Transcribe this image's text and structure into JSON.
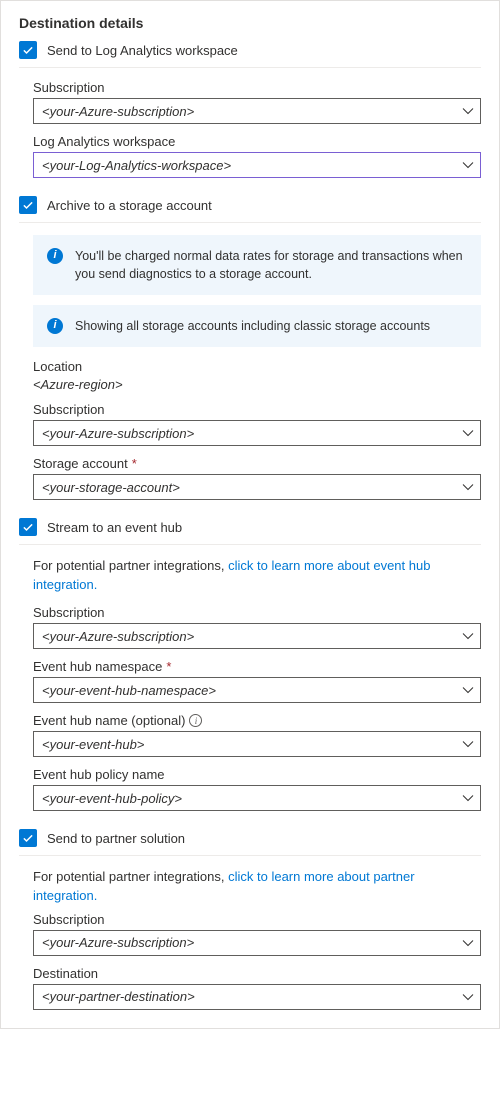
{
  "title": "Destination details",
  "sections": {
    "logAnalytics": {
      "checkbox_label": "Send to Log Analytics workspace",
      "subscription_label": "Subscription",
      "subscription_value": "<your-Azure-subscription>",
      "workspace_label": "Log Analytics workspace",
      "workspace_value": "<your-Log-Analytics-workspace>"
    },
    "storage": {
      "checkbox_label": "Archive to a storage account",
      "info1": "You'll be charged normal data rates for storage and transactions when you send diagnostics to a storage account.",
      "info2": "Showing all storage accounts including classic storage accounts",
      "location_label": "Location",
      "location_value": "<Azure-region>",
      "subscription_label": "Subscription",
      "subscription_value": "<your-Azure-subscription>",
      "account_label": "Storage account",
      "account_value": "<your-storage-account>"
    },
    "eventHub": {
      "checkbox_label": "Stream to an event hub",
      "partner_text": "For potential partner integrations, ",
      "partner_link": "click to learn more about event hub integration.",
      "subscription_label": "Subscription",
      "subscription_value": "<your-Azure-subscription>",
      "namespace_label": "Event hub namespace",
      "namespace_value": "<your-event-hub-namespace>",
      "name_label": "Event hub name (optional)",
      "name_value": "<your-event-hub>",
      "policy_label": "Event hub policy name",
      "policy_value": "<your-event-hub-policy>"
    },
    "partner": {
      "checkbox_label": "Send to partner solution",
      "partner_text": "For potential partner integrations, ",
      "partner_link": "click to learn more about partner integration.",
      "subscription_label": "Subscription",
      "subscription_value": "<your-Azure-subscription>",
      "destination_label": "Destination",
      "destination_value": "<your-partner-destination>"
    }
  },
  "required_marker": "*"
}
